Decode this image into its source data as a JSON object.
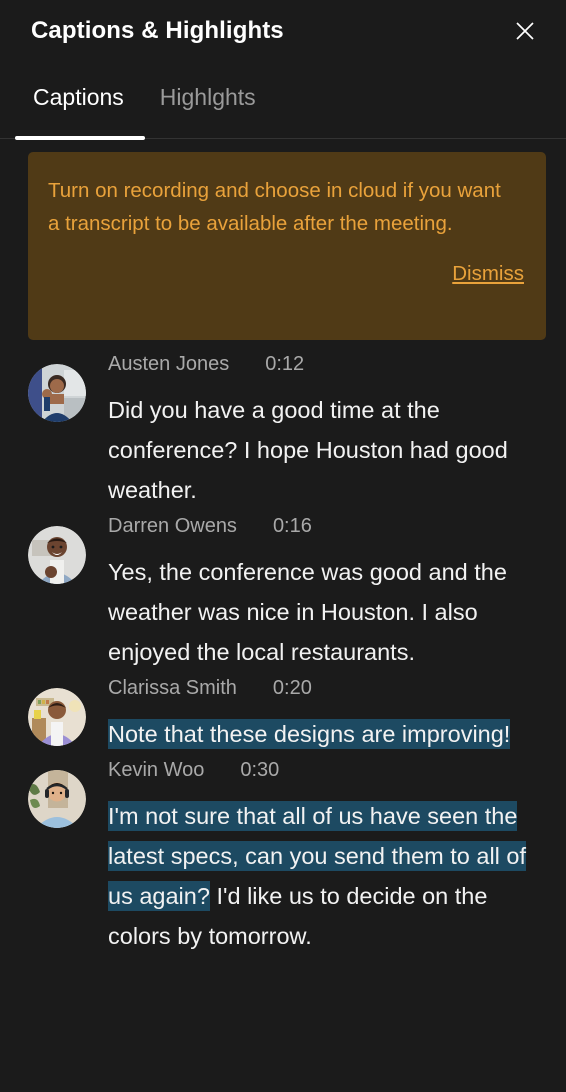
{
  "header": {
    "title": "Captions & Highlights",
    "close_icon": "close-icon"
  },
  "tabs": [
    {
      "label": "Captions",
      "active": true
    },
    {
      "label": "Highlghts",
      "active": false
    }
  ],
  "banner": {
    "message": "Turn on recording and choose in cloud if you want a transcript to be available after the meeting.",
    "dismiss_label": "Dismiss",
    "background_color": "#503a16",
    "text_color": "#e9a23b"
  },
  "colors": {
    "app_background": "#1b1b1b",
    "highlight": "#1d4a62",
    "accent_underline": "#ffffff",
    "speaker_text": "#a9a9a9"
  },
  "captions": [
    {
      "speaker": "Austen Jones",
      "timestamp": "0:12",
      "avatar": "avatar-austen-jones",
      "segments": [
        {
          "text": "Did you have a good time at the conference? I hope Houston had good weather.",
          "highlighted": false
        }
      ]
    },
    {
      "speaker": "Darren Owens",
      "timestamp": "0:16",
      "avatar": "avatar-darren-owens",
      "segments": [
        {
          "text": "Yes, the conference was good and the weather was nice in Houston. I also enjoyed the local restaurants.",
          "highlighted": false
        }
      ]
    },
    {
      "speaker": "Clarissa Smith",
      "timestamp": "0:20",
      "avatar": "avatar-clarissa-smith",
      "segments": [
        {
          "text": "Note that these designs are improving!",
          "highlighted": true
        }
      ]
    },
    {
      "speaker": "Kevin Woo",
      "timestamp": "0:30",
      "avatar": "avatar-kevin-woo",
      "segments": [
        {
          "text": "I'm not sure that all of us have seen the latest specs, can you send them to all of us again?",
          "highlighted": true
        },
        {
          "text": " I'd like us to decide on the colors by tomorrow.",
          "highlighted": false
        }
      ]
    }
  ]
}
